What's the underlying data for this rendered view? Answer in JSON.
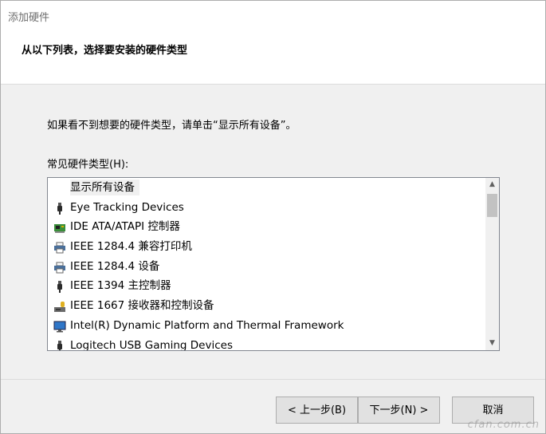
{
  "window": {
    "title": "添加硬件",
    "heading": "从以下列表，选择要安装的硬件类型"
  },
  "content": {
    "instruction": "如果看不到想要的硬件类型，请单击“显示所有设备”。",
    "list_label": "常见硬件类型(H):",
    "items": [
      {
        "label": "显示所有设备",
        "icon": "none",
        "selected": true
      },
      {
        "label": "Eye Tracking Devices",
        "icon": "usb-plug-icon"
      },
      {
        "label": "IDE ATA/ATAPI 控制器",
        "icon": "ide-controller-icon"
      },
      {
        "label": "IEEE 1284.4 兼容打印机",
        "icon": "printer-icon"
      },
      {
        "label": "IEEE 1284.4 设备",
        "icon": "printer-icon"
      },
      {
        "label": "IEEE 1394 主控制器",
        "icon": "usb-plug-icon"
      },
      {
        "label": "IEEE 1667 接收器和控制设备",
        "icon": "security-device-icon"
      },
      {
        "label": "Intel(R) Dynamic Platform and Thermal Framework",
        "icon": "monitor-icon"
      },
      {
        "label": "Logitech USB Gaming Devices",
        "icon": "usb-plug-icon"
      }
    ]
  },
  "buttons": {
    "back": "< 上一步(B)",
    "next": "下一步(N) >",
    "cancel": "取消"
  },
  "watermark": "cfan.com.cn"
}
